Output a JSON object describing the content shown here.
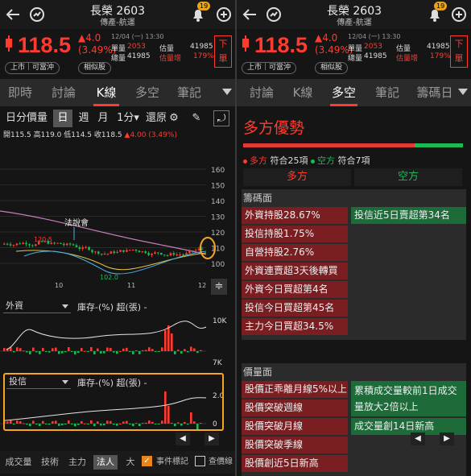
{
  "header": {
    "title": "長榮 2603",
    "subtitle": "傳產-航運",
    "notif_count": "19",
    "back_icon": "back-arrow-icon",
    "refresh_icon": "refresh-icon",
    "bell_icon": "bell-icon",
    "add_icon": "plus-circle-icon"
  },
  "quote": {
    "price": "118.5",
    "change": "4.0",
    "change_pct": "(3.49%)",
    "time": "12/04 (一) 13:30",
    "single_vol_label": "單量",
    "single_vol": "2053",
    "total_vol_label": "總量",
    "total_vol": "41985",
    "est_vol_label": "估量",
    "est_vol": "41985",
    "est_incr_label": "估量增",
    "est_incr": "179%",
    "order_label": "下單",
    "listing": "上市｜可當沖",
    "similar": "相似股",
    "up_color": "#ff3b30",
    "down_color": "#1db954"
  },
  "left": {
    "tabs": [
      "即時",
      "討論",
      "K線",
      "多空",
      "筆記"
    ],
    "active_tab": "K線",
    "periods": [
      "日分價量",
      "日",
      "週",
      "月",
      "1分",
      "還原"
    ],
    "active_period": "日",
    "ohlc": "開115.5 高119.0 低114.5 收118.5 ",
    "ohlc_change": "4.00 (3.49%)",
    "y_ticks": [
      "160",
      "150",
      "140",
      "130",
      "120",
      "110",
      "100"
    ],
    "x_ticks": [
      "10",
      "11",
      "12"
    ],
    "event_label": "法說會",
    "high_marker": "120.5",
    "low_marker": "102.0",
    "panel1": {
      "select": "外資",
      "label": "庫存-(%) 超(張) -",
      "tick_top": "10K",
      "tick_bottom": "7K"
    },
    "panel2": {
      "select": "投信",
      "label": "庫存-(%) 超(張) -",
      "tick_top": "2.0",
      "tick_bottom": "0"
    },
    "bottom_tabs": [
      "成交量",
      "技術",
      "主力",
      "法人",
      "大戶"
    ],
    "active_bottom": "法人",
    "event_toggle": "事件標記",
    "query_toggle": "查價線"
  },
  "right": {
    "tabs": [
      "討論",
      "K線",
      "多空",
      "筆記",
      "籌碼日"
    ],
    "active_tab": "多空",
    "title": "多方優勢",
    "bull_ratio": 0.781,
    "bull_label": "多方",
    "bull_count": "符合25項",
    "bear_label": "空方",
    "bear_count": "符合7項",
    "col_bull": "多方",
    "col_bear": "空方",
    "sections": [
      {
        "title": "籌碼面",
        "bull": [
          "外資持股28.67%",
          "投信持股1.75%",
          "自營持股2.76%",
          "外資連賣超3天後轉買",
          "外資今日買超第4名",
          "投信今日買超第45名",
          "主力今日買超34.5%"
        ],
        "bear": [
          "投信近5日賣超第34名"
        ]
      },
      {
        "title": "價量面",
        "bull": [
          "股價正乖離月線5%以上",
          "股價突破週線",
          "股價突破月線",
          "股價突破季線",
          "股價創近5日新高"
        ],
        "bear": [
          "累積成交量較前1日成交量放大2倍以上",
          "成交量創14日新高"
        ]
      }
    ]
  }
}
